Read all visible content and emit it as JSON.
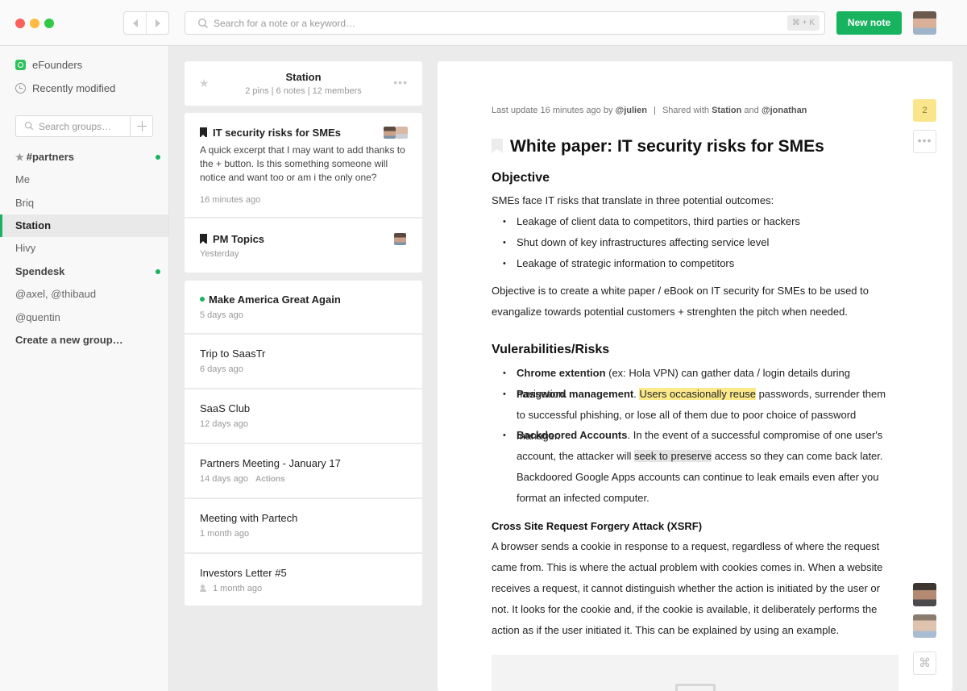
{
  "topbar": {
    "search_placeholder": "Search for a note or a keyword…",
    "search_shortcut": "⌘ + K",
    "new_note_label": "New note"
  },
  "sidebar": {
    "workspace": "eFounders",
    "recent": "Recently modified",
    "search_placeholder": "Search groups…",
    "groups": [
      {
        "label": "#partners",
        "bold": true,
        "star": true,
        "dot": true
      },
      {
        "label": "Me"
      },
      {
        "label": "Briq"
      },
      {
        "label": "Station",
        "active": true
      },
      {
        "label": "Hivy"
      },
      {
        "label": "Spendesk",
        "bold": true,
        "dot": true
      },
      {
        "label": "@axel, @thibaud"
      },
      {
        "label": "@quentin"
      },
      {
        "label": "Create a new group…",
        "bold": true
      }
    ]
  },
  "group_header": {
    "title": "Station",
    "subtitle": "2 pins | 6 notes | 12 members"
  },
  "pinned_notes": [
    {
      "title": "IT security risks for SMEs",
      "excerpt": "A quick excerpt that I may want to add thanks to the + button. Is this something someone will notice and want too or am i the only one?",
      "date": "16 minutes ago"
    },
    {
      "title": "PM Topics",
      "date": "Yesterday"
    }
  ],
  "notes": [
    {
      "title": "Make America Great Again",
      "date": "5 days ago"
    },
    {
      "title": "Trip to SaasTr",
      "date": "6 days ago"
    },
    {
      "title": "SaaS Club",
      "date": "12 days ago"
    },
    {
      "title": "Partners Meeting - January 17",
      "date": "14 days ago",
      "tag": "Actions"
    },
    {
      "title": "Meeting with Partech",
      "date": "1 month ago"
    },
    {
      "title": "Investors Letter #5",
      "date": "1 month ago"
    }
  ],
  "document": {
    "meta_prefix": "Last update 16 minutes ago by ",
    "meta_author": "@julien",
    "meta_sep": "|",
    "meta_shared": "Shared with ",
    "meta_group": "Station",
    "meta_and": " and ",
    "meta_user": "@jonathan",
    "comment_count": "2",
    "title": "White paper: IT security risks for SMEs",
    "section1_heading": "Objective",
    "intro": "SMEs face IT risks that translate in three potential outcomes:",
    "outcomes": [
      "Leakage of client data to competitors, third parties or hackers",
      "Shut down of key infrastructures affecting service level",
      "Leakage of strategic information to competitors"
    ],
    "objective": "Objective is to create a white paper / eBook on IT security for SMEs to be used to evangalize towards potential customers + strenghten the pitch when needed.",
    "section2_heading": "Vulerabilities/Risks",
    "risk1_bold": "Chrome extention",
    "risk1_text": " (ex: Hola VPN) can gather data / login details during navigation.",
    "risk2_bold": "Password management",
    "risk2_pre": ". ",
    "risk2_highlight": "Users occasionally reuse",
    "risk2_text": " passwords, surrender them to successful phishing, or lose all of them due to poor choice of password manager.",
    "risk3_bold": "Backdoored Accounts",
    "risk3_pre": ". In the event of a successful compromise of one user's account, the attacker will ",
    "risk3_highlight": "seek to preserve",
    "risk3_text": " access so they can come back later. Backdoored Google Apps accounts can continue to leak emails even after you format an infected computer.",
    "section3_heading": "Cross Site Request Forgery Attack (XSRF)",
    "xsrf": "A browser sends a cookie in response to a request, regardless of where the request came from. This is where the actual problem with cookies comes in. When a website receives a request, it cannot distinguish whether the action is initiated by the user or not. It looks for the cookie and, if the cookie is available, it deliberately performs the action as if the user initiated it. This can be explained by using an example."
  }
}
